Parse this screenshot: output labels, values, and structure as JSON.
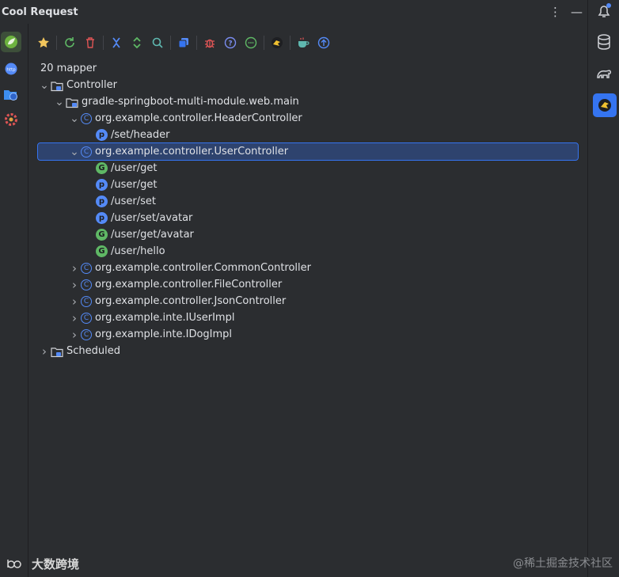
{
  "window": {
    "title": "Cool Request"
  },
  "title_actions": {
    "more": "⋮",
    "minimize": "—"
  },
  "tree": {
    "root_summary": "20 mapper",
    "rows": [
      {
        "label": "Controller",
        "indent": 0,
        "chevron": "v",
        "icon": "folder"
      },
      {
        "label": "gradle-springboot-multi-module.web.main",
        "indent": 1,
        "chevron": "v",
        "icon": "module"
      },
      {
        "label": "org.example.controller.HeaderController",
        "indent": 2,
        "chevron": "v",
        "icon": "C"
      },
      {
        "label": "/set/header",
        "indent": 3,
        "chevron": "",
        "icon": "P"
      },
      {
        "label": "org.example.controller.UserController",
        "indent": 2,
        "chevron": "v",
        "icon": "C",
        "selected": true
      },
      {
        "label": "/user/get",
        "indent": 3,
        "chevron": "",
        "icon": "G"
      },
      {
        "label": "/user/get",
        "indent": 3,
        "chevron": "",
        "icon": "P"
      },
      {
        "label": "/user/set",
        "indent": 3,
        "chevron": "",
        "icon": "P"
      },
      {
        "label": "/user/set/avatar",
        "indent": 3,
        "chevron": "",
        "icon": "P"
      },
      {
        "label": "/user/get/avatar",
        "indent": 3,
        "chevron": "",
        "icon": "G"
      },
      {
        "label": "/user/hello",
        "indent": 3,
        "chevron": "",
        "icon": "G"
      },
      {
        "label": "org.example.controller.CommonController",
        "indent": 2,
        "chevron": ">",
        "icon": "C"
      },
      {
        "label": "org.example.controller.FileController",
        "indent": 2,
        "chevron": ">",
        "icon": "C"
      },
      {
        "label": "org.example.controller.JsonController",
        "indent": 2,
        "chevron": ">",
        "icon": "C"
      },
      {
        "label": "org.example.inte.IUserImpl",
        "indent": 2,
        "chevron": ">",
        "icon": "C"
      },
      {
        "label": "org.example.inte.IDogImpl",
        "indent": 2,
        "chevron": ">",
        "icon": "C"
      },
      {
        "label": "Scheduled",
        "indent": 0,
        "chevron": ">",
        "icon": "folder"
      }
    ]
  },
  "watermarks": {
    "left": "大数跨境",
    "right": "@稀土掘金技术社区"
  },
  "colors": {
    "accent": "#3574f0",
    "get_badge": "#5fb865",
    "post_badge": "#548af7",
    "selection": "#2e436e"
  }
}
